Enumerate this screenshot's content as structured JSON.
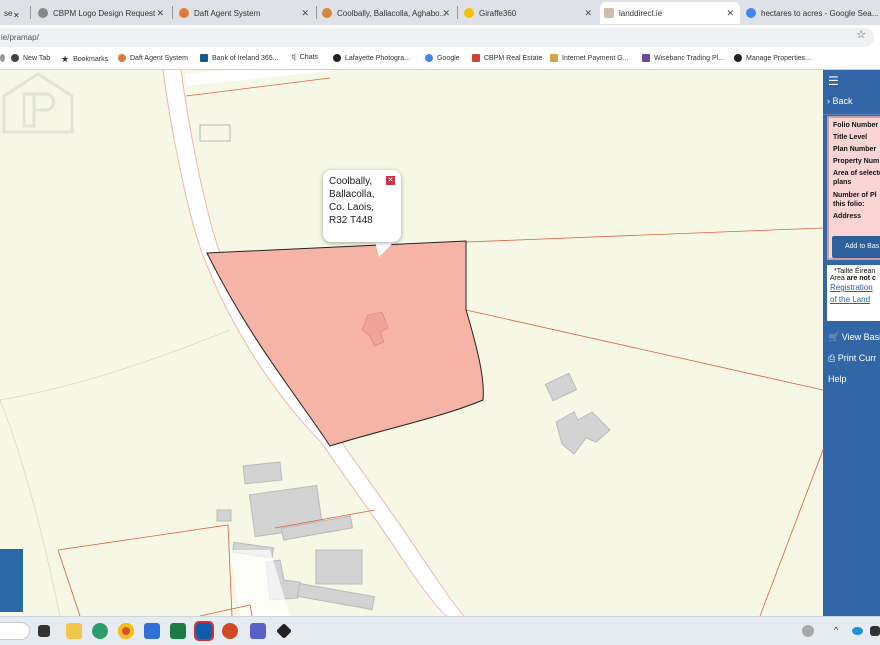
{
  "browser": {
    "tabs": [
      {
        "label": "se",
        "active": false
      },
      {
        "label": "CBPM Logo Design Request",
        "active": false
      },
      {
        "label": "Daft Agent System",
        "active": false
      },
      {
        "label": "Coolbally, Ballacolla, Aghabo...",
        "active": false
      },
      {
        "label": "Giraffe360",
        "active": false
      },
      {
        "label": "landdirect.ie",
        "active": true
      },
      {
        "label": "hectares to acres - Google Sea...",
        "active": false
      }
    ],
    "url": "ie/pramap/",
    "bookmarks": [
      "New Tab",
      "Bookmarks",
      "Daft Agent System",
      "Bank of Ireland 365...",
      "Chats",
      "Lafayette Photogra...",
      "Google",
      "CBPM Real Estate",
      "Internet Payment G...",
      "Wisebanc Trading Pl...",
      "Manage Properties..."
    ]
  },
  "map": {
    "popup": {
      "lines": [
        "Coolbally,",
        "Ballacolla,",
        "Co. Laois,",
        "R32 T448"
      ]
    },
    "parcel_color": "#f6b4a6",
    "boundary_color": "#d9623c"
  },
  "sidebar": {
    "back_label": "Back",
    "fields": [
      "Folio Number",
      "Title Level",
      "Plan Number",
      "Property Num",
      "Area of selecte",
      "plans",
      "Number of Pl",
      "this folio:",
      "Address"
    ],
    "add_button": "Add to Bas",
    "note_line1": "*Tailte Éirean",
    "note_line2_prefix": "Area ",
    "note_line2_bold": "are not c",
    "note_link1": "Registration",
    "note_link2": "of the Land",
    "links": [
      "View Basi",
      "Print Curr",
      "Help"
    ]
  },
  "colors": {
    "sidebar_bg": "#3366a6",
    "info_bg": "#fbd4d4",
    "map_bg": "#f6f8e5"
  }
}
